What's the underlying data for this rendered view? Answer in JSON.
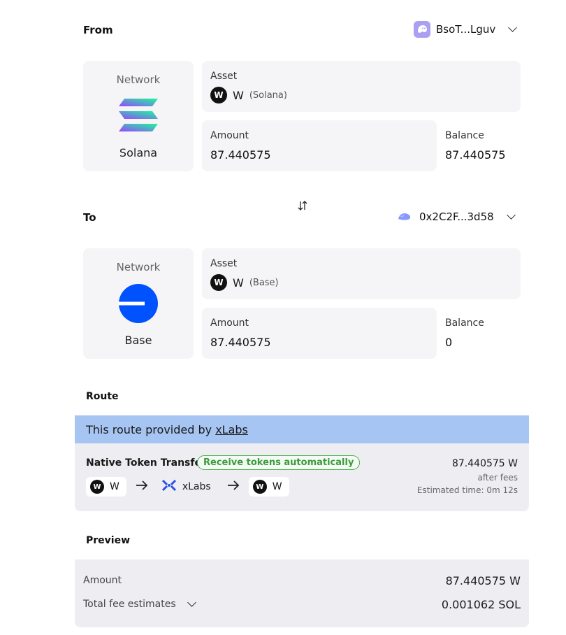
{
  "from": {
    "label": "From",
    "wallet": "BsoT...Lguv",
    "network_label": "Network",
    "network_name": "Solana",
    "asset_label": "Asset",
    "asset_symbol": "W",
    "asset_chain": "(Solana)",
    "amount_label": "Amount",
    "amount_value": "87.440575",
    "balance_label": "Balance",
    "balance_value": "87.440575"
  },
  "to": {
    "label": "To",
    "wallet": "0x2C2F...3d58",
    "network_label": "Network",
    "network_name": "Base",
    "asset_label": "Asset",
    "asset_symbol": "W",
    "asset_chain": "(Base)",
    "amount_label": "Amount",
    "amount_value": "87.440575",
    "balance_label": "Balance",
    "balance_value": "0"
  },
  "route": {
    "label": "Route",
    "provided_prefix": "This route provided by ",
    "provider": "xLabs",
    "name": "Native Token Transfer",
    "badge": "Receive tokens automatically",
    "amount": "87.440575 W",
    "after_fees": "after fees",
    "eta": "Estimated time: 0m 12s",
    "steps": [
      "W",
      "xLabs",
      "W"
    ]
  },
  "preview": {
    "label": "Preview",
    "amount_label": "Amount",
    "amount_value": "87.440575 W",
    "fee_label": "Total fee estimates",
    "fee_value": "0.001062 SOL"
  },
  "colors": {
    "card_bg": "#f5f5f7",
    "route_banner": "#a6c5f3",
    "base_blue": "#0052ff",
    "badge_green": "#4caf50",
    "phantom_purple": "#ab9ff2"
  }
}
